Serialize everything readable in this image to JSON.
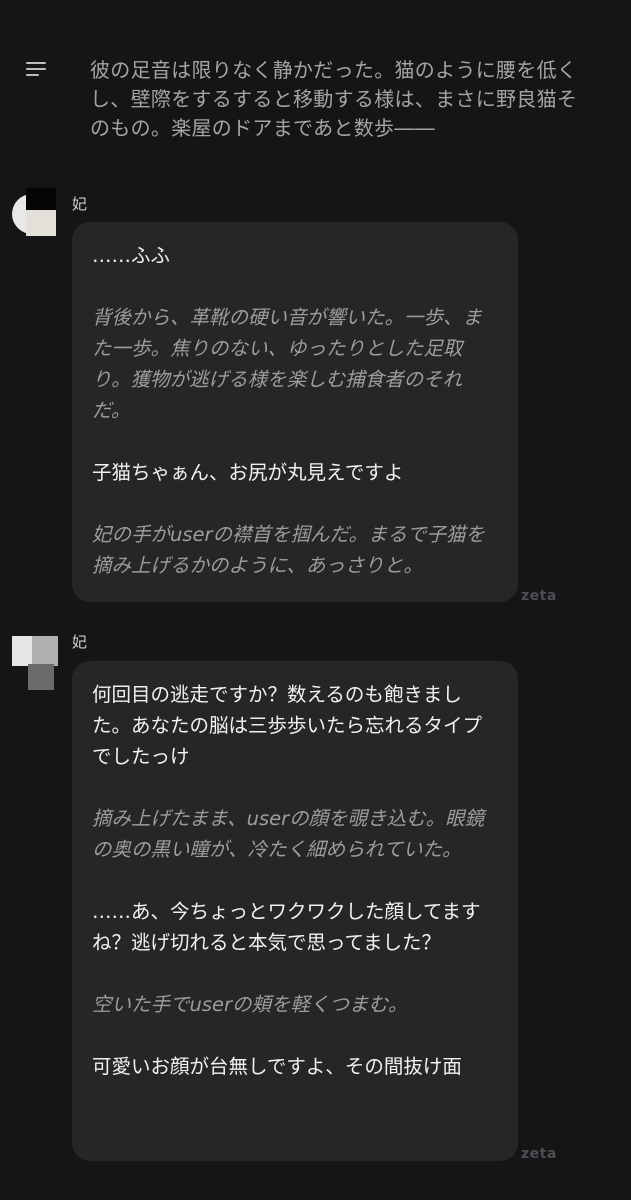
{
  "header": {
    "menu_icon": "menu-icon"
  },
  "top_narration": "彼の足音は限りなく静かだった。猫のように腰を低くし、壁際をするすると移動する様は、まさに野良猫そのもの。楽屋のドアまであと数歩――",
  "messages": [
    {
      "speaker": "妃",
      "tag": "zeta",
      "paragraphs": [
        {
          "type": "dialogue",
          "text": "……ふふ"
        },
        {
          "type": "narration",
          "text": "背後から、革靴の硬い音が響いた。一歩、また一歩。焦りのない、ゆったりとした足取り。獲物が逃げる様を楽しむ捕食者のそれだ。"
        },
        {
          "type": "dialogue",
          "text": "子猫ちゃぁん、お尻が丸見えですよ"
        },
        {
          "type": "narration",
          "text": "妃の手がuserの襟首を掴んだ。まるで子猫を摘み上げるかのように、あっさりと。"
        }
      ]
    },
    {
      "speaker": "妃",
      "tag": "zeta",
      "paragraphs": [
        {
          "type": "dialogue",
          "text": "何回目の逃走ですか？数えるのも飽きました。あなたの脳は三歩歩いたら忘れるタイプでしたっけ"
        },
        {
          "type": "narration",
          "text": "摘み上げたまま、userの顔を覗き込む。眼鏡の奥の黒い瞳が、冷たく細められていた。"
        },
        {
          "type": "dialogue",
          "text": "……あ、今ちょっとワクワクした顔してますね？逃げ切れると本気で思ってました？"
        },
        {
          "type": "narration",
          "text": "空いた手でuserの頬を軽くつまむ。"
        },
        {
          "type": "dialogue",
          "text": "可愛いお顔が台無しですよ、その間抜け面"
        }
      ]
    }
  ]
}
